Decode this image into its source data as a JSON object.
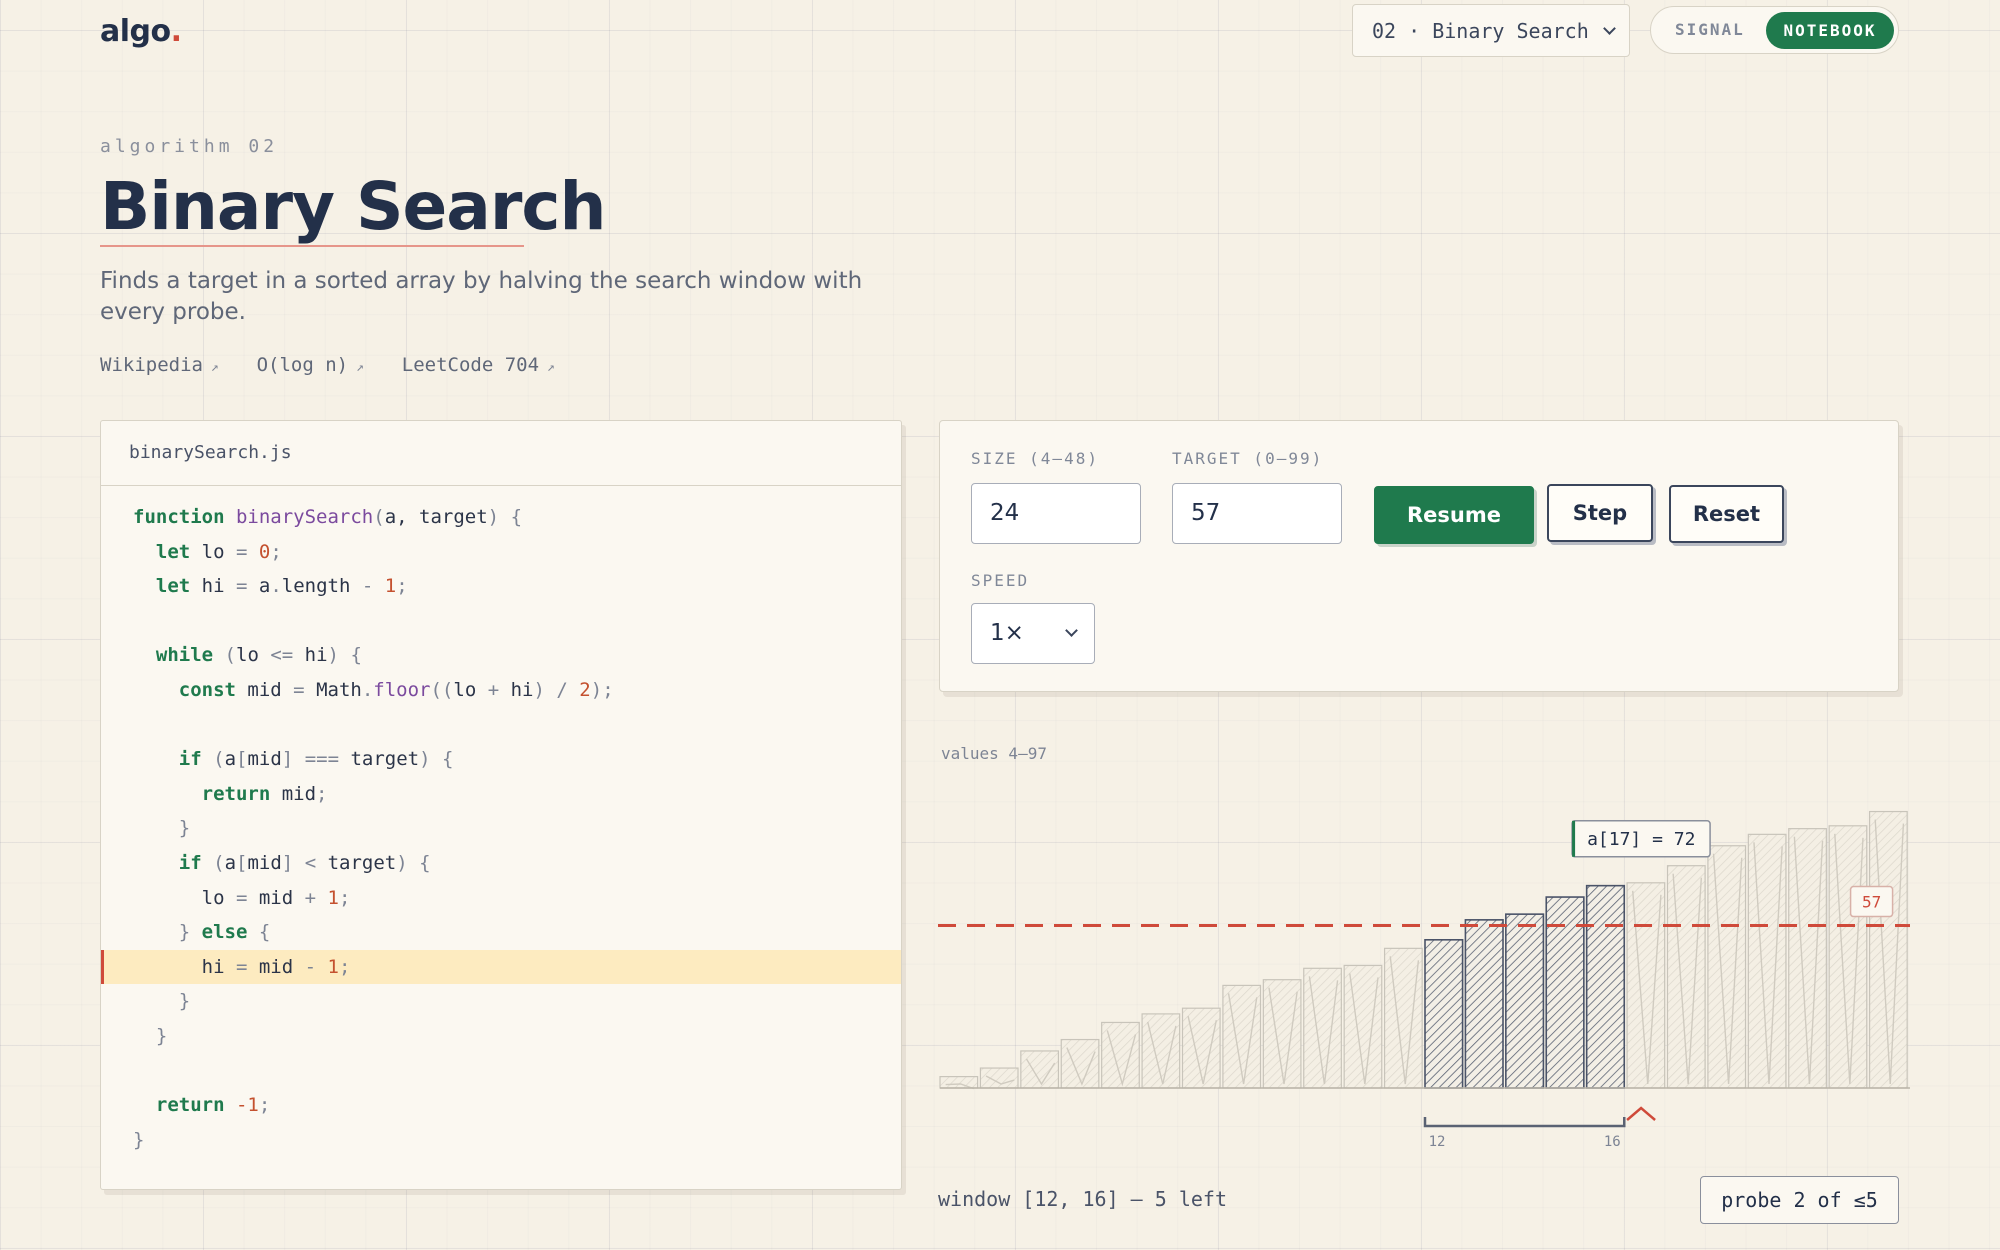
{
  "header": {
    "logo_text": "algo",
    "logo_dot": ".",
    "algorithm_select_value": "02 · Binary Search",
    "mode_toggle": {
      "options": [
        "SIGNAL",
        "NOTEBOOK"
      ],
      "selected": "NOTEBOOK"
    }
  },
  "intro": {
    "eyebrow": "algorithm 02",
    "title": "Binary Search",
    "description": "Finds a target in a sorted array by halving the search window with every probe.",
    "links": [
      "Wikipedia",
      "O(log n)",
      "LeetCode 704"
    ]
  },
  "code": {
    "filename": "binarySearch.js",
    "active_line_index": 13,
    "lines": [
      [
        [
          "kw",
          "function"
        ],
        [
          "t",
          " "
        ],
        [
          "fn",
          "binarySearch"
        ],
        [
          "op",
          "("
        ],
        [
          "t",
          "a, target"
        ],
        [
          "op",
          ")"
        ],
        [
          "t",
          " "
        ],
        [
          "op",
          "{"
        ]
      ],
      [
        [
          "t",
          "  "
        ],
        [
          "kw",
          "let"
        ],
        [
          "t",
          " lo "
        ],
        [
          "op",
          "="
        ],
        [
          "t",
          " "
        ],
        [
          "num",
          "0"
        ],
        [
          "op",
          ";"
        ]
      ],
      [
        [
          "t",
          "  "
        ],
        [
          "kw",
          "let"
        ],
        [
          "t",
          " hi "
        ],
        [
          "op",
          "="
        ],
        [
          "t",
          " a"
        ],
        [
          "op",
          "."
        ],
        [
          "t",
          "length "
        ],
        [
          "op",
          "-"
        ],
        [
          "t",
          " "
        ],
        [
          "num",
          "1"
        ],
        [
          "op",
          ";"
        ]
      ],
      [],
      [
        [
          "t",
          "  "
        ],
        [
          "kw",
          "while"
        ],
        [
          "t",
          " "
        ],
        [
          "op",
          "("
        ],
        [
          "t",
          "lo "
        ],
        [
          "op",
          "<="
        ],
        [
          "t",
          " hi"
        ],
        [
          "op",
          ")"
        ],
        [
          "t",
          " "
        ],
        [
          "op",
          "{"
        ]
      ],
      [
        [
          "t",
          "    "
        ],
        [
          "kw",
          "const"
        ],
        [
          "t",
          " mid "
        ],
        [
          "op",
          "="
        ],
        [
          "t",
          " Math"
        ],
        [
          "op",
          "."
        ],
        [
          "fn",
          "floor"
        ],
        [
          "op",
          "(("
        ],
        [
          "t",
          "lo "
        ],
        [
          "op",
          "+"
        ],
        [
          "t",
          " hi"
        ],
        [
          "op",
          ")"
        ],
        [
          "t",
          " "
        ],
        [
          "op",
          "/"
        ],
        [
          "t",
          " "
        ],
        [
          "num",
          "2"
        ],
        [
          "op",
          ");"
        ]
      ],
      [],
      [
        [
          "t",
          "    "
        ],
        [
          "kw",
          "if"
        ],
        [
          "t",
          " "
        ],
        [
          "op",
          "("
        ],
        [
          "t",
          "a"
        ],
        [
          "op",
          "["
        ],
        [
          "t",
          "mid"
        ],
        [
          "op",
          "]"
        ],
        [
          "t",
          " "
        ],
        [
          "op",
          "==="
        ],
        [
          "t",
          " target"
        ],
        [
          "op",
          ")"
        ],
        [
          "t",
          " "
        ],
        [
          "op",
          "{"
        ]
      ],
      [
        [
          "t",
          "      "
        ],
        [
          "kw",
          "return"
        ],
        [
          "t",
          " mid"
        ],
        [
          "op",
          ";"
        ]
      ],
      [
        [
          "t",
          "    "
        ],
        [
          "op",
          "}"
        ]
      ],
      [
        [
          "t",
          "    "
        ],
        [
          "kw",
          "if"
        ],
        [
          "t",
          " "
        ],
        [
          "op",
          "("
        ],
        [
          "t",
          "a"
        ],
        [
          "op",
          "["
        ],
        [
          "t",
          "mid"
        ],
        [
          "op",
          "]"
        ],
        [
          "t",
          " "
        ],
        [
          "op",
          "<"
        ],
        [
          "t",
          " target"
        ],
        [
          "op",
          ")"
        ],
        [
          "t",
          " "
        ],
        [
          "op",
          "{"
        ]
      ],
      [
        [
          "t",
          "      lo "
        ],
        [
          "op",
          "="
        ],
        [
          "t",
          " mid "
        ],
        [
          "op",
          "+"
        ],
        [
          "t",
          " "
        ],
        [
          "num",
          "1"
        ],
        [
          "op",
          ";"
        ]
      ],
      [
        [
          "t",
          "    "
        ],
        [
          "op",
          "}"
        ],
        [
          "t",
          " "
        ],
        [
          "kw",
          "else"
        ],
        [
          "t",
          " "
        ],
        [
          "op",
          "{"
        ]
      ],
      [
        [
          "t",
          "      hi "
        ],
        [
          "op",
          "="
        ],
        [
          "t",
          " mid "
        ],
        [
          "op",
          "-"
        ],
        [
          "t",
          " "
        ],
        [
          "num",
          "1"
        ],
        [
          "op",
          ";"
        ]
      ],
      [
        [
          "t",
          "    "
        ],
        [
          "op",
          "}"
        ]
      ],
      [
        [
          "t",
          "  "
        ],
        [
          "op",
          "}"
        ]
      ],
      [],
      [
        [
          "t",
          "  "
        ],
        [
          "kw",
          "return"
        ],
        [
          "t",
          " "
        ],
        [
          "num",
          "-1"
        ],
        [
          "op",
          ";"
        ]
      ],
      [
        [
          "op",
          "}"
        ]
      ]
    ]
  },
  "controls": {
    "size_label": "SIZE (4–48)",
    "size_value": "24",
    "target_label": "TARGET (0–99)",
    "target_value": "57",
    "resume_label": "Resume",
    "step_label": "Step",
    "reset_label": "Reset",
    "speed_label": "SPEED",
    "speed_value": "1×"
  },
  "chart": {
    "values_label": "values 4–97",
    "window_text": "window [12, 16] — 5 left",
    "probe_text": "probe 2 of ≤5"
  },
  "chart_data": {
    "type": "bar",
    "categories": [
      0,
      1,
      2,
      3,
      4,
      5,
      6,
      7,
      8,
      9,
      10,
      11,
      12,
      13,
      14,
      15,
      16,
      17,
      18,
      19,
      20,
      21,
      22,
      23
    ],
    "values": [
      4,
      7,
      13,
      17,
      23,
      26,
      28,
      36,
      38,
      42,
      43,
      49,
      52,
      59,
      61,
      67,
      71,
      72,
      78,
      85,
      89,
      91,
      92,
      97
    ],
    "target": 57,
    "target_label": "57",
    "window": [
      12,
      16
    ],
    "window_labels": [
      "12",
      "16"
    ],
    "probe_index": 17,
    "probe_label": "a[17] = 72",
    "ylim": [
      0,
      100
    ],
    "colors": {
      "target_line": "#cf4a3a",
      "active_bar": "#4a5368",
      "inactive_bar": "#c8c4ba"
    }
  },
  "theme": {
    "accent_green": "#1f7a4d",
    "accent_red": "#cf4a3a",
    "ink": "#233049",
    "paper": "#f6f1e6"
  }
}
